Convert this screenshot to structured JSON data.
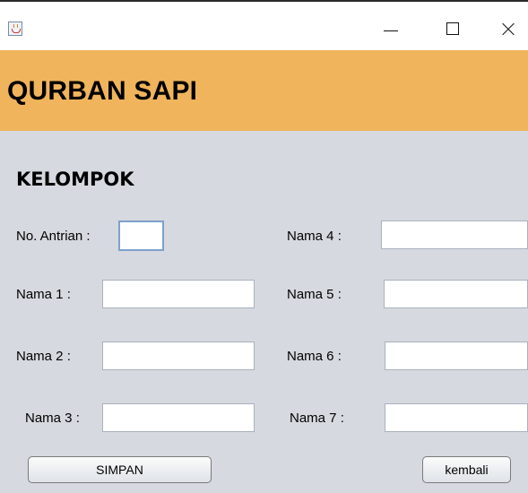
{
  "window": {
    "minimize": "minimize",
    "maximize": "maximize",
    "close": "close"
  },
  "header": {
    "title": "QURBAN SAPI"
  },
  "section": {
    "title": "KELOMPOK"
  },
  "form": {
    "antrian_label": "No. Antrian :",
    "nama1_label": "Nama 1 :",
    "nama2_label": "Nama 2 :",
    "nama3_label": "Nama 3 :",
    "nama4_label": "Nama 4 :",
    "nama5_label": "Nama 5 :",
    "nama6_label": "Nama 6 :",
    "nama7_label": "Nama 7 :",
    "antrian_value": "",
    "nama1_value": "",
    "nama2_value": "",
    "nama3_value": "",
    "nama4_value": "",
    "nama5_value": "",
    "nama6_value": "",
    "nama7_value": ""
  },
  "buttons": {
    "simpan": "SIMPAN",
    "kembali": "kembali"
  },
  "icons": {
    "app": "java-app-icon",
    "minimize": "minimize-icon",
    "maximize": "maximize-icon",
    "close": "close-icon"
  },
  "colors": {
    "header_band": "#f0b45c",
    "panel_bg": "#d6d9df"
  }
}
